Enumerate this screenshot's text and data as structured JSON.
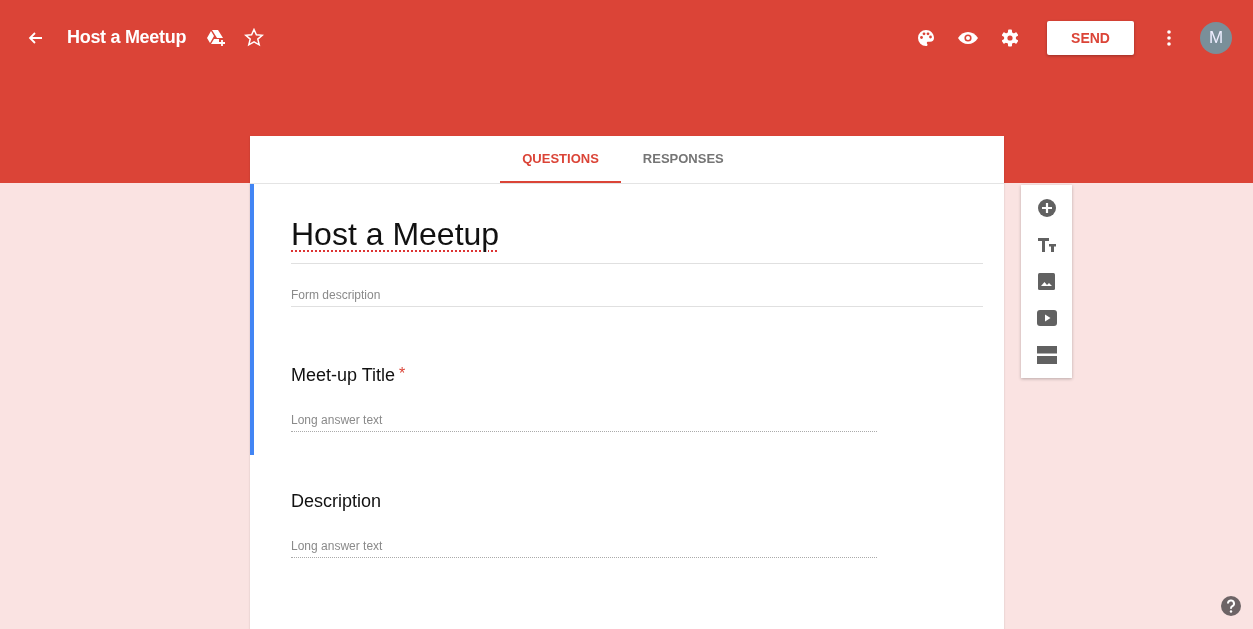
{
  "header": {
    "title": "Host a Meetup",
    "send_button": "SEND",
    "avatar": "M"
  },
  "tabs": [
    {
      "label": "QUESTIONS",
      "selected": true
    },
    {
      "label": "RESPONSES",
      "selected": false
    }
  ],
  "form": {
    "title": "Host a Meetup",
    "description_placeholder": "Form description",
    "selected": true
  },
  "required_marker": "*",
  "questions": [
    {
      "title": "Meet-up Title",
      "required": true,
      "placeholder": "Long answer text",
      "selected": true
    },
    {
      "title": "Description",
      "required": false,
      "placeholder": "Long answer text",
      "selected": false
    }
  ]
}
